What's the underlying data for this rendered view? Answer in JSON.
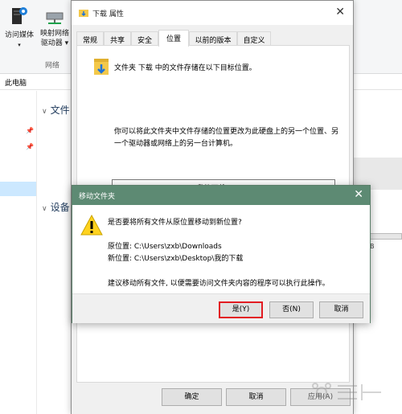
{
  "ribbon": {
    "access_media_label": "访问媒体",
    "map_drive_label_line1": "映射网络",
    "map_drive_label_line2": "驱动器",
    "group_label": "网络"
  },
  "address_bar": {
    "text": "此电脑"
  },
  "explorer": {
    "section_folders": "文件",
    "section_devices": "设备",
    "drive_size_text": "B"
  },
  "properties_dialog": {
    "title": "下载 属性",
    "tabs": [
      "常规",
      "共享",
      "安全",
      "位置",
      "以前的版本",
      "自定义"
    ],
    "active_tab": "位置",
    "location_text": "文件夹 下载 中的文件存储在以下目标位置。",
    "description": "你可以将此文件夹中文件存储的位置更改为此硬盘上的另一个位置、另一个驱动器或网络上的另一台计算机。",
    "path_value": "C:\\Users\\zxb\\Desktop\\我的下载",
    "ok_label": "确定",
    "cancel_label": "取消",
    "apply_label": "应用(A)"
  },
  "move_dialog": {
    "title": "移动文件夹",
    "question": "是否要将所有文件从原位置移动到新位置?",
    "original_location": "原位置: C:\\Users\\zxb\\Downloads",
    "new_location": "新位置: C:\\Users\\zxb\\Desktop\\我的下载",
    "advice": "建议移动所有文件, 以便需要访问文件夹内容的程序可以执行此操作。",
    "yes_label": "是(Y)",
    "no_label": "否(N)",
    "cancel_label": "取消",
    "title_bar_color": "#5d8a73",
    "highlight_color": "#e21b22"
  },
  "icons": {
    "media": "media-server-icon",
    "network_drive": "network-drive-icon",
    "folder": "downloads-folder-icon",
    "warning": "warning-icon",
    "pin": "pin-icon"
  }
}
